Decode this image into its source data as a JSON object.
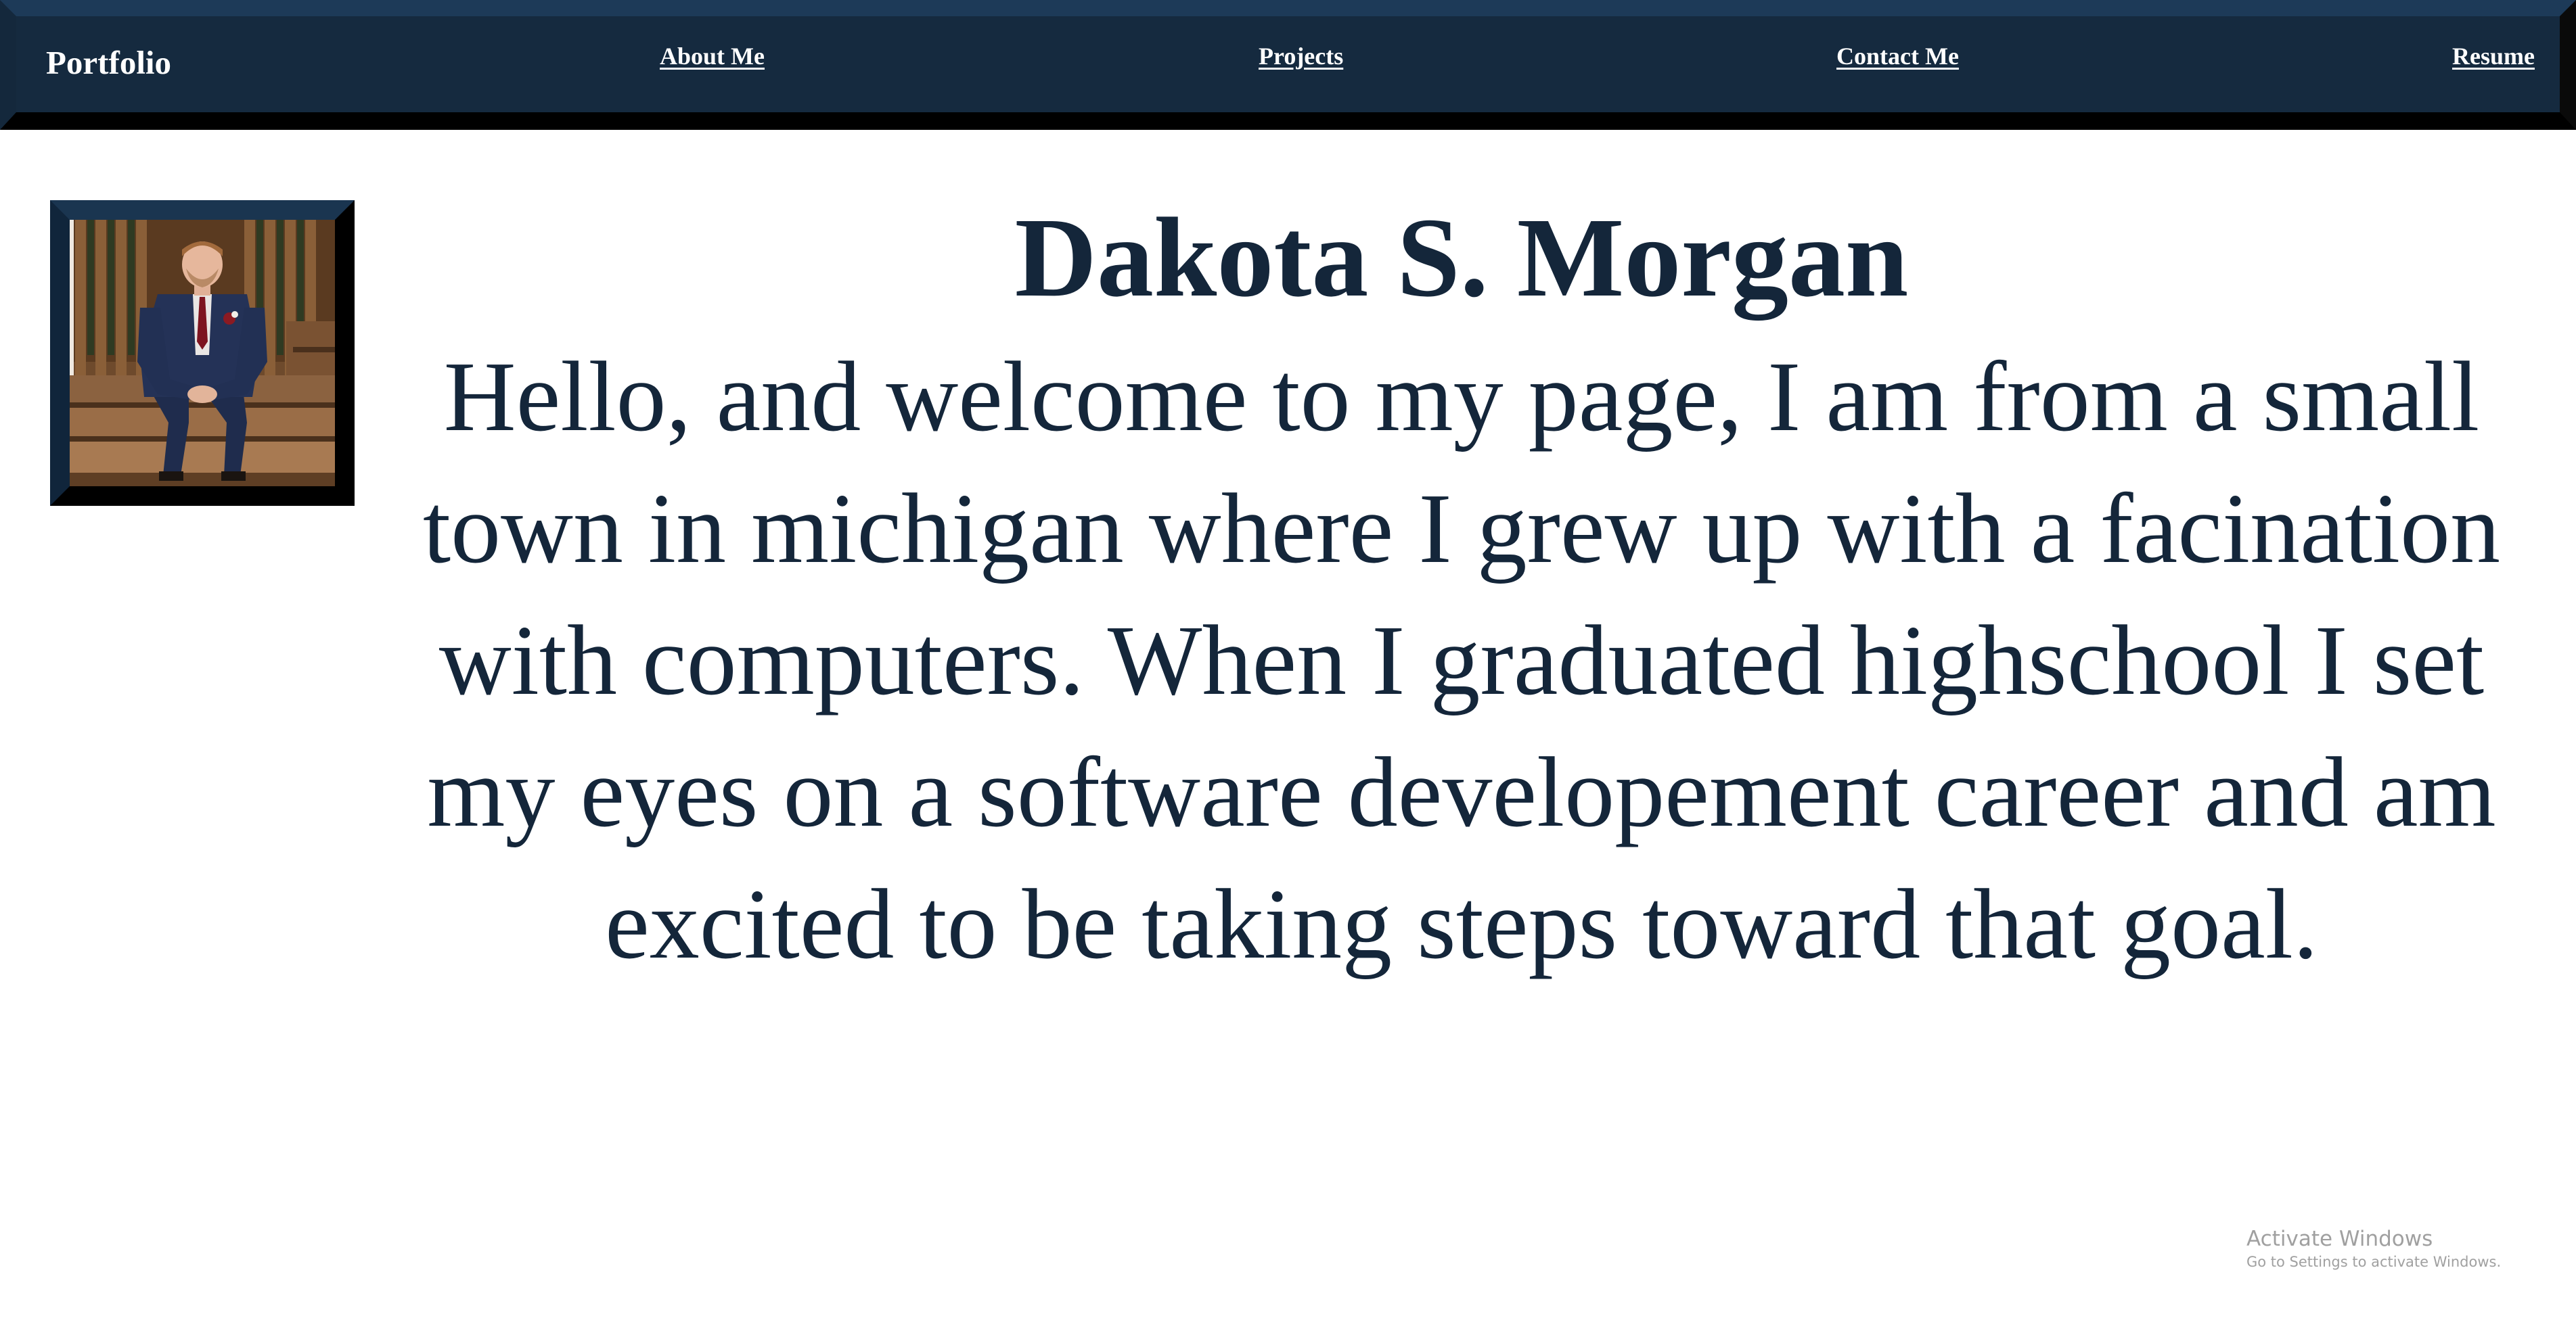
{
  "header": {
    "brand": "Portfolio",
    "nav": {
      "about": "About Me",
      "projects": "Projects",
      "contact": "Contact Me",
      "resume": "Resume"
    }
  },
  "profile": {
    "name": "Dakota S. Morgan",
    "bio": "Hello, and welcome to my page, I am from a small town in michigan where I grew up with a facination with computers. When I graduated highschool I set my eyes on a software developement career and am excited to be taking steps toward that goal.",
    "photo": "portrait-photo"
  },
  "watermark": {
    "title": "Activate Windows",
    "subtitle": "Go to Settings to activate Windows."
  },
  "colors": {
    "navbar": "#152a3f",
    "text": "#14263a",
    "background": "#ffffff"
  }
}
